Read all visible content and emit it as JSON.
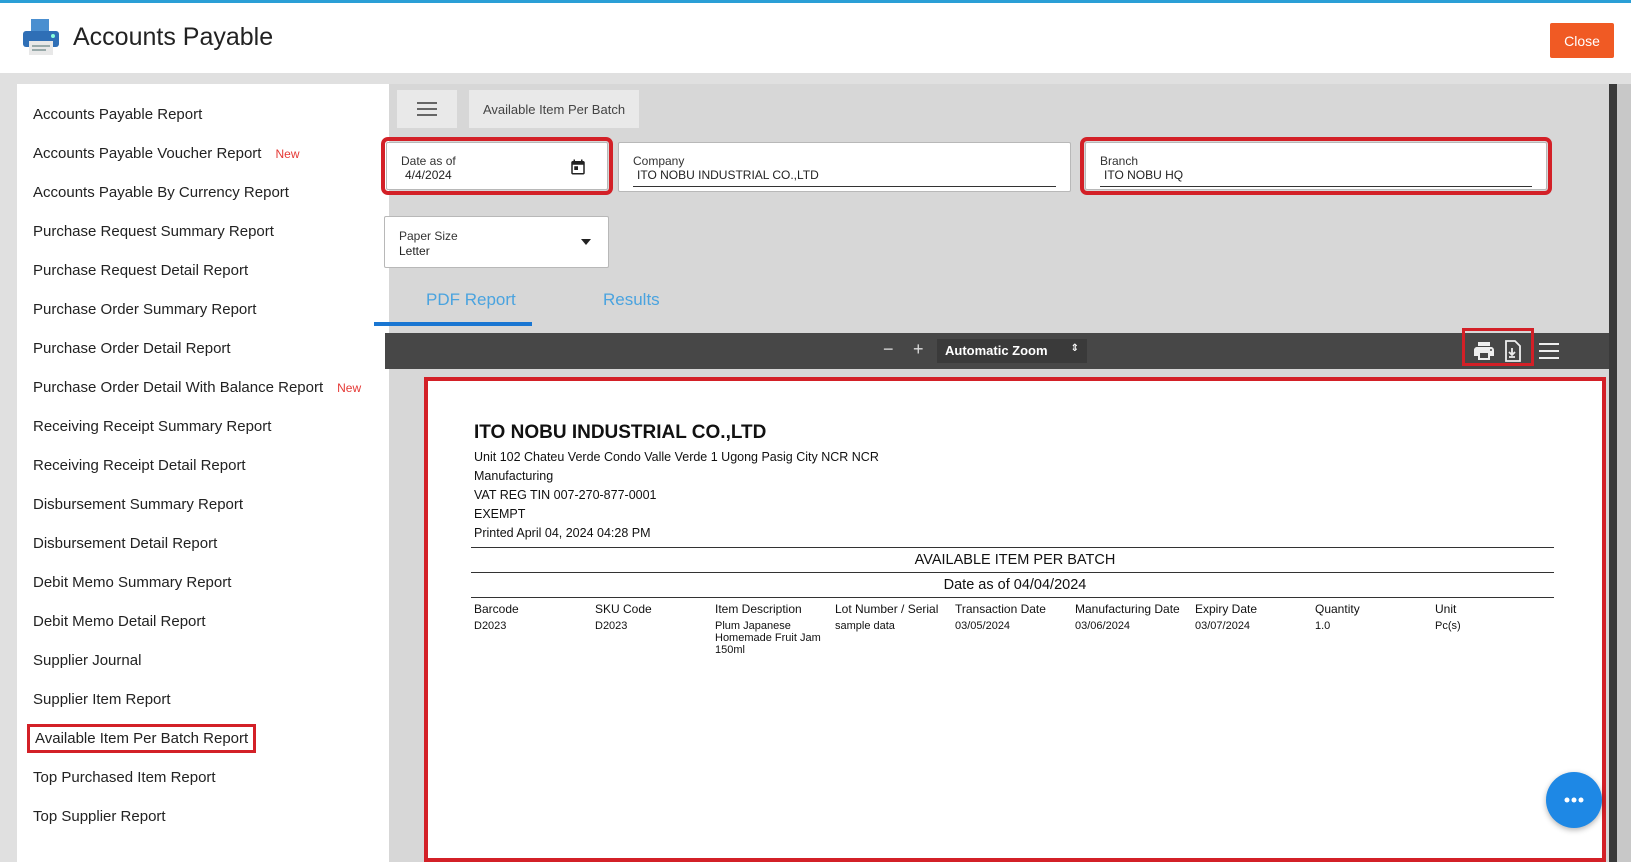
{
  "app": {
    "title": "Accounts Payable",
    "close_label": "Close"
  },
  "colors": {
    "accent": "#2a9fd6",
    "close": "#f05a24",
    "highlight": "#d32027",
    "tab": "#4aa3df",
    "fab": "#1e88e5"
  },
  "sidebar": {
    "items": [
      {
        "label": "Accounts Payable Report",
        "badge": ""
      },
      {
        "label": "Accounts Payable Voucher Report",
        "badge": "New"
      },
      {
        "label": "Accounts Payable By Currency Report",
        "badge": ""
      },
      {
        "label": "Purchase Request Summary Report",
        "badge": ""
      },
      {
        "label": "Purchase Request Detail Report",
        "badge": ""
      },
      {
        "label": "Purchase Order Summary Report",
        "badge": ""
      },
      {
        "label": "Purchase Order Detail Report",
        "badge": ""
      },
      {
        "label": "Purchase Order Detail With Balance Report",
        "badge": "New"
      },
      {
        "label": "Receiving Receipt Summary Report",
        "badge": ""
      },
      {
        "label": "Receiving Receipt Detail Report",
        "badge": ""
      },
      {
        "label": "Disbursement Summary Report",
        "badge": ""
      },
      {
        "label": "Disbursement Detail Report",
        "badge": ""
      },
      {
        "label": "Debit Memo Summary Report",
        "badge": ""
      },
      {
        "label": "Debit Memo Detail Report",
        "badge": ""
      },
      {
        "label": "Supplier Journal",
        "badge": ""
      },
      {
        "label": "Supplier Item Report",
        "badge": ""
      },
      {
        "label": "Available Item Per Batch Report",
        "badge": ""
      },
      {
        "label": "Top Purchased Item Report",
        "badge": ""
      },
      {
        "label": "Top Supplier Report",
        "badge": ""
      }
    ]
  },
  "main": {
    "breadcrumb_tab": "Available Item Per Batch",
    "date": {
      "label": "Date as of",
      "value": "4/4/2024"
    },
    "company": {
      "label": "Company",
      "value": "ITO NOBU INDUSTRIAL CO.,LTD"
    },
    "branch": {
      "label": "Branch",
      "value": "ITO NOBU HQ"
    },
    "paper": {
      "label": "Paper Size",
      "value": "Letter"
    },
    "tabs": [
      {
        "label": "PDF Report"
      },
      {
        "label": "Results"
      }
    ],
    "viewer": {
      "zoom_label": "Automatic Zoom",
      "minus": "−",
      "plus": "+"
    }
  },
  "report": {
    "company": "ITO NOBU INDUSTRIAL CO.,LTD",
    "address": "Unit 102 Chateu Verde Condo Valle Verde 1 Ugong  Pasig City NCR NCR",
    "industry": "Manufacturing",
    "tin": "VAT REG TIN 007-270-877-0001",
    "vat": "EXEMPT",
    "printed": "Printed April 04, 2024 04:28 PM",
    "title": "AVAILABLE ITEM PER BATCH",
    "subtitle": "Date as of 04/04/2024",
    "columns": [
      "Barcode",
      "SKU Code",
      "Item Description",
      "Lot Number / Serial",
      "Transaction Date",
      "Manufacturing Date",
      "Expiry Date",
      "Quantity",
      "Unit"
    ],
    "rows": [
      [
        "D2023",
        "D2023",
        "Plum  Japanese Homemade Fruit Jam 150ml",
        "sample data",
        "03/05/2024",
        "03/06/2024",
        "03/07/2024",
        "1.0",
        "Pc(s)"
      ]
    ]
  }
}
